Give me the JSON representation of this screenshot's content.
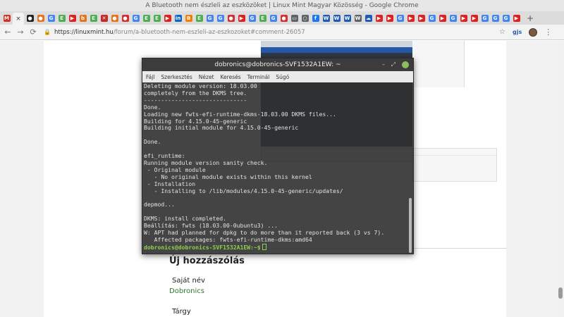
{
  "window": {
    "title": "A Bluetooth nem észleli az eszközöket | Linux Mint Magyar Közösség - Google Chrome"
  },
  "tabs": [
    {
      "icon": "mail-icon",
      "color": "#d93025",
      "glyph": "M"
    },
    {
      "icon": "close-icon",
      "color": "#888888",
      "glyph": "×",
      "active": true
    },
    {
      "icon": "app-icon",
      "color": "#222222",
      "glyph": "●"
    },
    {
      "icon": "orange-icon",
      "color": "#e8731a",
      "glyph": "●"
    },
    {
      "icon": "google-icon",
      "color": "#4285f4",
      "glyph": "G"
    },
    {
      "icon": "chat-icon",
      "color": "#4caf50",
      "glyph": "E"
    },
    {
      "icon": "youtube-icon",
      "color": "#e02020",
      "glyph": "▶"
    },
    {
      "icon": "orange2-icon",
      "color": "#e8731a",
      "glyph": "b"
    },
    {
      "icon": "chat2-icon",
      "color": "#4caf50",
      "glyph": "E"
    },
    {
      "icon": "x-icon",
      "color": "#c62828",
      "glyph": "✕"
    },
    {
      "icon": "orange3-icon",
      "color": "#e8731a",
      "glyph": "●"
    },
    {
      "icon": "red-icon",
      "color": "#d32f2f",
      "glyph": "●"
    },
    {
      "icon": "google2-icon",
      "color": "#4285f4",
      "glyph": "G"
    },
    {
      "icon": "chat3-icon",
      "color": "#4caf50",
      "glyph": "E"
    },
    {
      "icon": "chat4-icon",
      "color": "#4caf50",
      "glyph": "E"
    },
    {
      "icon": "youtube2-icon",
      "color": "#e02020",
      "glyph": "▶"
    },
    {
      "icon": "linkedin-icon",
      "color": "#0a66c2",
      "glyph": "in"
    },
    {
      "icon": "blogger-icon",
      "color": "#f57c00",
      "glyph": "B"
    },
    {
      "icon": "chat5-icon",
      "color": "#4caf50",
      "glyph": "E"
    },
    {
      "icon": "google3-icon",
      "color": "#4285f4",
      "glyph": "G"
    },
    {
      "icon": "google4-icon",
      "color": "#4285f4",
      "glyph": "G"
    },
    {
      "icon": "red2-icon",
      "color": "#d32f2f",
      "glyph": "●"
    },
    {
      "icon": "youtube3-icon",
      "color": "#e02020",
      "glyph": "▶"
    },
    {
      "icon": "google5-icon",
      "color": "#4285f4",
      "glyph": "G"
    },
    {
      "icon": "chat6-icon",
      "color": "#4caf50",
      "glyph": "E"
    },
    {
      "icon": "google6-icon",
      "color": "#4285f4",
      "glyph": "G"
    },
    {
      "icon": "red3-icon",
      "color": "#d32f2f",
      "glyph": "●"
    },
    {
      "icon": "doc-icon",
      "color": "#5f6368",
      "glyph": "▭"
    },
    {
      "icon": "circle-icon",
      "color": "#5f6368",
      "glyph": "○"
    },
    {
      "icon": "facebook-icon",
      "color": "#1877f2",
      "glyph": "f"
    },
    {
      "icon": "word-icon",
      "color": "#1e5bb8",
      "glyph": "W"
    },
    {
      "icon": "word2-icon",
      "color": "#1e5bb8",
      "glyph": "W"
    },
    {
      "icon": "word3-icon",
      "color": "#1e5bb8",
      "glyph": "W"
    },
    {
      "icon": "wiki-icon",
      "color": "#5f6368",
      "glyph": "W"
    },
    {
      "icon": "onedrive-icon",
      "color": "#1e5bb8",
      "glyph": "☁"
    },
    {
      "icon": "youtube4-icon",
      "color": "#e02020",
      "glyph": "▶"
    },
    {
      "icon": "youtube5-icon",
      "color": "#e02020",
      "glyph": "▶"
    },
    {
      "icon": "google7-icon",
      "color": "#4285f4",
      "glyph": "G"
    },
    {
      "icon": "youtube6-icon",
      "color": "#e02020",
      "glyph": "▶"
    },
    {
      "icon": "youtube7-icon",
      "color": "#e02020",
      "glyph": "▶"
    },
    {
      "icon": "google8-icon",
      "color": "#4285f4",
      "glyph": "G"
    },
    {
      "icon": "youtube8-icon",
      "color": "#e02020",
      "glyph": "▶"
    },
    {
      "icon": "google9-icon",
      "color": "#4285f4",
      "glyph": "G"
    },
    {
      "icon": "youtube9-icon",
      "color": "#e02020",
      "glyph": "▶"
    },
    {
      "icon": "youtube10-icon",
      "color": "#e02020",
      "glyph": "▶"
    },
    {
      "icon": "google10-icon",
      "color": "#4285f4",
      "glyph": "G"
    },
    {
      "icon": "google11-icon",
      "color": "#4285f4",
      "glyph": "G"
    },
    {
      "icon": "google12-icon",
      "color": "#4285f4",
      "glyph": "G"
    },
    {
      "icon": "youtube11-icon",
      "color": "#e02020",
      "glyph": "▶"
    }
  ],
  "toolbar": {
    "url_host": "https://linuxmint.hu",
    "url_path": "/forum/a-bluetooth-nem-eszleli-az-eszkozoket#comment-26057",
    "extension_label": "gjs"
  },
  "page": {
    "new_comment_heading": "Új hozzászólás",
    "name_label": "Saját név",
    "name_value": "Dobronics",
    "subject_label": "Tárgy"
  },
  "terminal": {
    "title": "dobronics@dobronics-SVF1532A1EW: ~",
    "menu": [
      "Fájl",
      "Szerkesztés",
      "Nézet",
      "Keresés",
      "Terminál",
      "Súgó"
    ],
    "lines": [
      "Deleting module version: 18.03.00",
      "completely from the DKMS tree.",
      "------------------------------",
      "Done.",
      "Loading new fwts-efi-runtime-dkms-18.03.00 DKMS files...",
      "Building for 4.15.0-45-generic",
      "Building initial module for 4.15.0-45-generic",
      "",
      "Done.",
      "",
      "efi_runtime:",
      "Running module version sanity check.",
      " - Original module",
      "   - No original module exists within this kernel",
      " - Installation",
      "   - Installing to /lib/modules/4.15.0-45-generic/updates/",
      "",
      "depmod...",
      "",
      "DKMS: install completed.",
      "Beállítás: fwts (18.03.00-0ubuntu3) ...",
      "W: APT had planned for dpkg to do more than it reported back (3 vs 7).",
      "   Affected packages: fwts-efi-runtime-dkms:amd64"
    ],
    "prompt": "dobronics@dobronics-SVF1532A1EW:~$"
  }
}
